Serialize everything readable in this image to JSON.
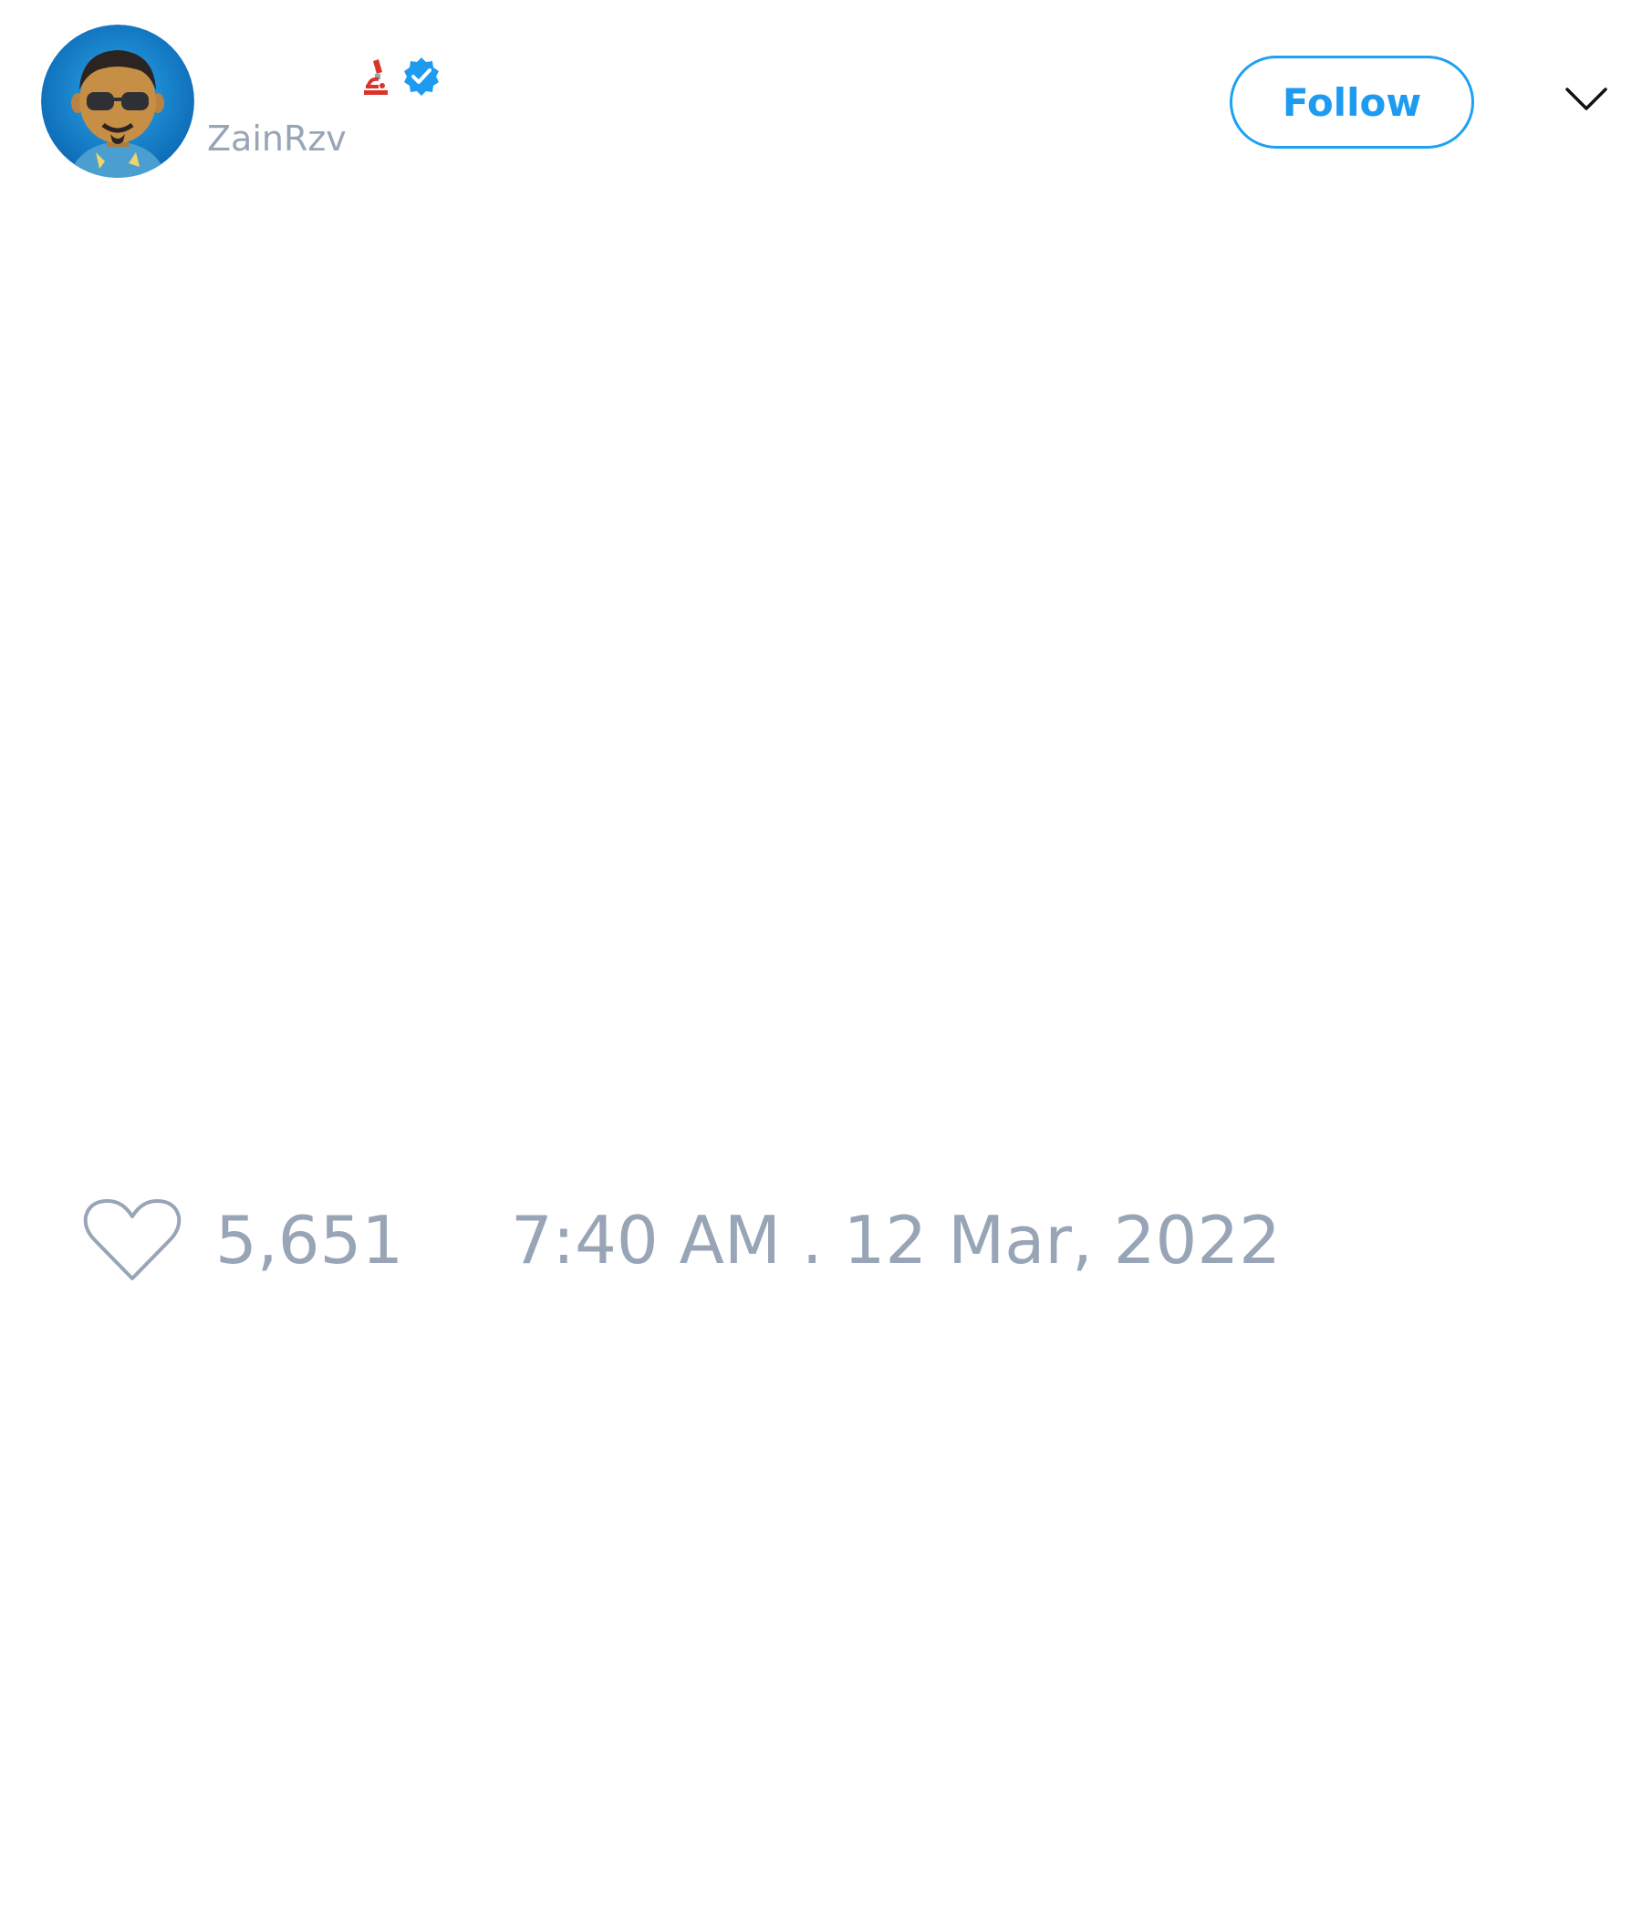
{
  "tweet": {
    "author": {
      "handle": "ZainRzv",
      "name_emoji_icon": "microscope-icon",
      "verified_icon": "verified-badge-icon"
    },
    "follow_label": "Follow",
    "menu_icon": "chevron-down-icon",
    "like_icon": "heart-icon",
    "like_count": "5,651",
    "timestamp": "7:40 AM . 12 Mar, 2022"
  },
  "colors": {
    "accent": "#1d9bf0",
    "secondary_text": "#98a5b7",
    "background": "#ffffff"
  }
}
